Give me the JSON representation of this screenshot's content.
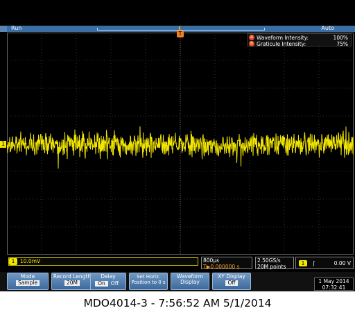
{
  "status_bar": {
    "run_state": "Run",
    "acquisition_mode": "Auto"
  },
  "markers": {
    "trigger_marker": "T",
    "channel_marker": "1"
  },
  "intensity": {
    "waveform": {
      "badge": "a",
      "label": "Waveform Intensity:",
      "value": "100%"
    },
    "graticule": {
      "badge": "b",
      "label": "Graticule Intensity:",
      "value": "75%"
    }
  },
  "channel1": {
    "tag": "1",
    "scale": "10.0mV"
  },
  "timebase": {
    "scale": "800µs",
    "delay_icon": "T▶",
    "delay": "0.000000 s"
  },
  "sampling": {
    "rate": "2.50GS/s",
    "record": "20M points"
  },
  "trigger": {
    "source": "1",
    "slope_icon": "rising-edge",
    "slope_glyph": "ʃ",
    "level": "0.00 V"
  },
  "softkeys": [
    {
      "label": "Mode",
      "value": "Sample"
    },
    {
      "label": "Record Length",
      "value": "20M"
    },
    {
      "label": "Delay",
      "on": "On",
      "off": "Off"
    },
    {
      "label": "Set Horiz. Position to 0 s"
    },
    {
      "label": "Waveform Display"
    },
    {
      "label": "XY Display",
      "value": "Off"
    }
  ],
  "datetime": {
    "date": "1 May 2014",
    "time": "07:32:41"
  },
  "caption": "MDO4014-3 - 7:56:52 AM   5/1/2014",
  "colors": {
    "channel1": "#f2e600",
    "trigger": "#f08020",
    "status_bar": "#3a6ea5",
    "background": "#000000"
  }
}
